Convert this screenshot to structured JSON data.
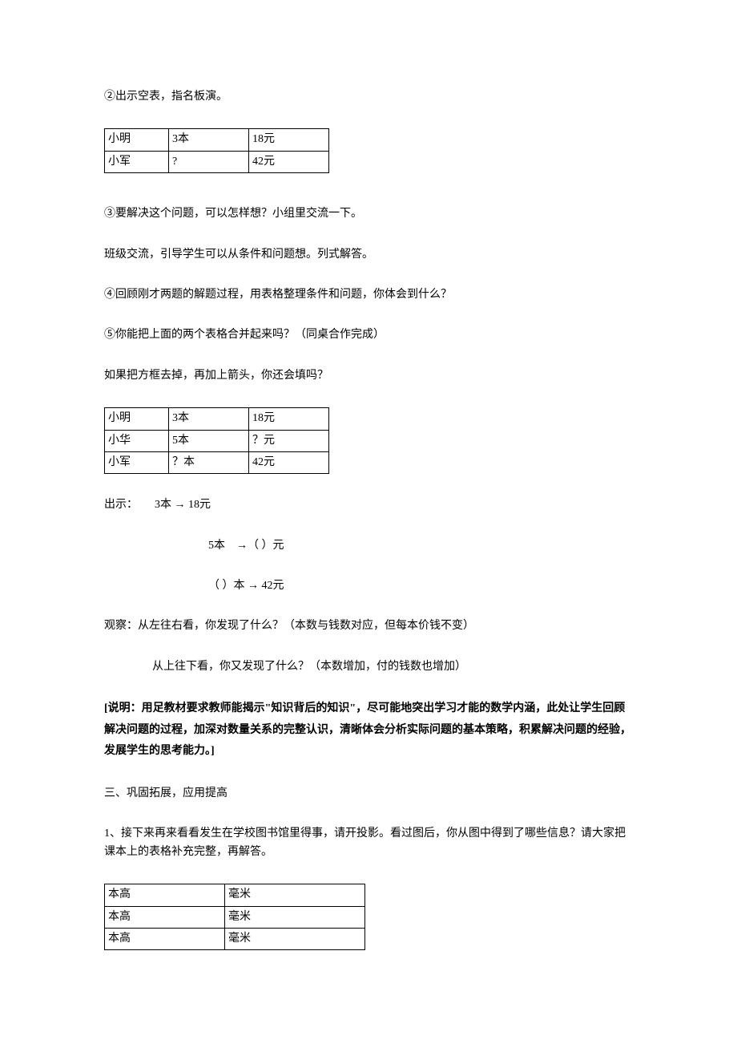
{
  "paragraphs": {
    "p1": "②出示空表，指名板演。",
    "p2": "③要解决这个问题，可以怎样想？小组里交流一下。",
    "p3": "班级交流，引导学生可以从条件和问题想。列式解答。",
    "p4": "④回顾刚才两题的解题过程，用表格整理条件和问题，你体会到什么？",
    "p5": "⑤你能把上面的两个表格合并起来吗？（同桌合作完成）",
    "p6": "如果把方框去掉，再加上箭头，你还会填吗？",
    "p7": "出示：　　3本 → 18元",
    "p8": "5本　→（ ）元",
    "p9": "（ ）本 → 42元",
    "p10": "观察：从左往右看，你发现了什么？（本数与钱数对应，但每本价钱不变）",
    "p11": "从上往下看，你又发现了什么？（本数增加，付的钱数也增加）",
    "p12": "[说明：用足教材要求教师能揭示\"知识背后的知识\"，尽可能地突出学习才能的数学内涵，此处让学生回顾解决问题的过程，加深对数量关系的完整认识，清晰体会分析实际问题的基本策略，积累解决问题的经验，发展学生的思考能力。]",
    "p13": "三、巩固拓展，应用提高",
    "p14": "1、接下来再来看看发生在学校图书馆里得事，请开投影。看过图后，你从图中得到了哪些信息？请大家把课本上的表格补充完整，再解答。"
  },
  "table1": {
    "r1c1": "小明",
    "r1c2": "3本",
    "r1c3": "18元",
    "r2c1": "小军",
    "r2c2": "?",
    "r2c3": "42元"
  },
  "table2": {
    "r1c1": "小明",
    "r1c2": "3本",
    "r1c3": "18元",
    "r2c1": "小华",
    "r2c2": "5本",
    "r2c3": "？元",
    "r3c1": "小军",
    "r3c2": "？本",
    "r3c3": "42元"
  },
  "table3": {
    "r1c1": "本高",
    "r1c2": "毫米",
    "r2c1": "本高",
    "r2c2": "毫米",
    "r3c1": "本高",
    "r3c2": "毫米"
  }
}
